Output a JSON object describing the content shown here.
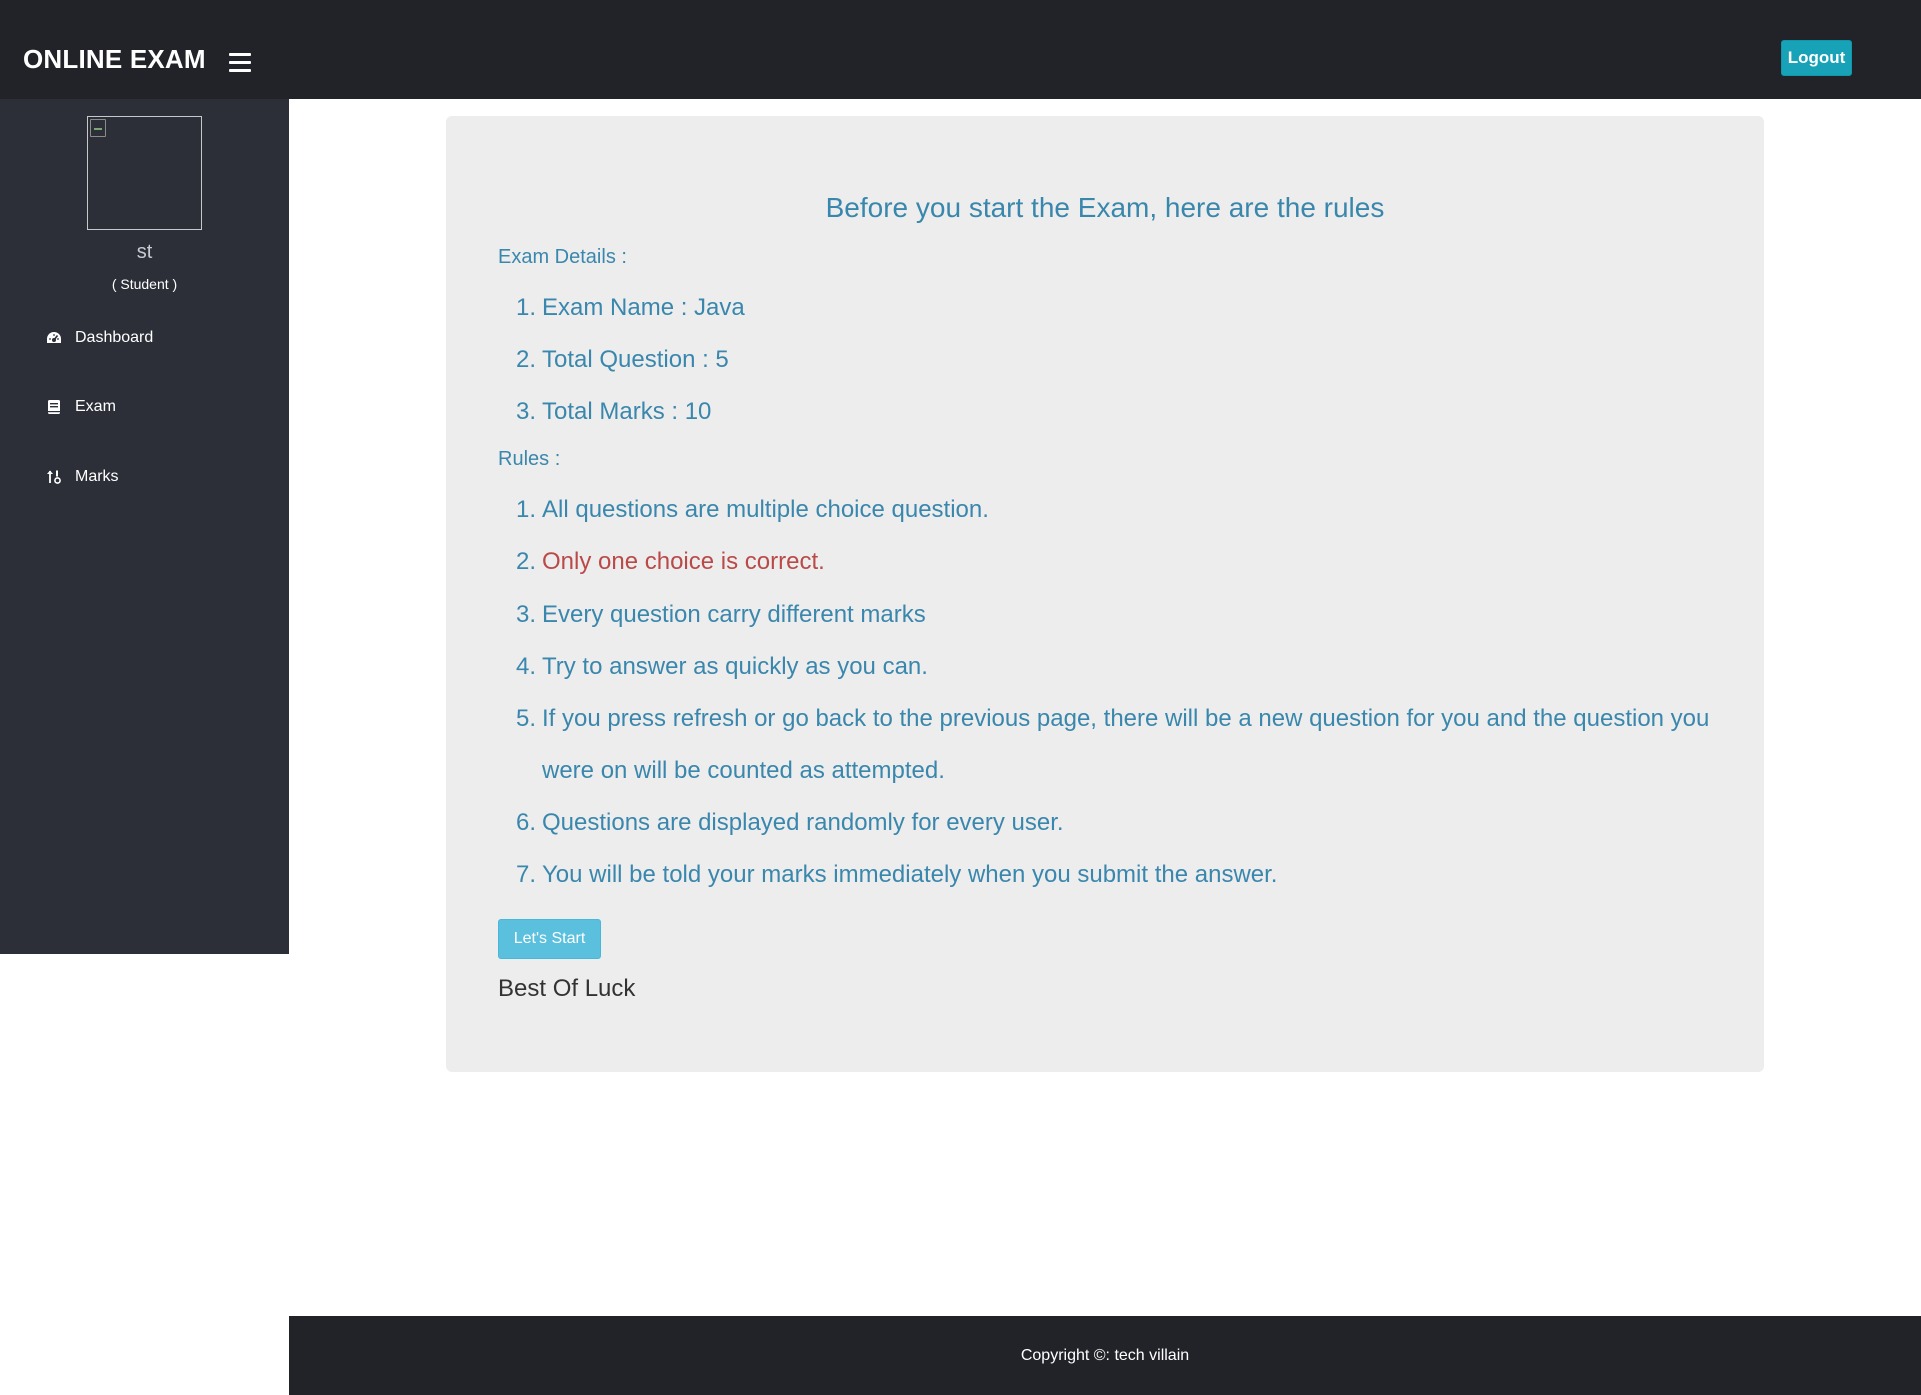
{
  "header": {
    "brand": "ONLINE EXAM",
    "menu_icon": "hamburger-menu-icon",
    "logout_label": "Logout"
  },
  "sidebar": {
    "avatar_icon": "broken-image-icon",
    "user_name": "st",
    "user_role": "( Student )",
    "items": [
      {
        "label": "Dashboard",
        "icon": "dashboard-icon"
      },
      {
        "label": "Exam",
        "icon": "book-icon"
      },
      {
        "label": "Marks",
        "icon": "sort-numeric-icon"
      }
    ]
  },
  "main": {
    "title": "Before you start the Exam, here are the rules",
    "exam_details_label": "Exam Details :",
    "exam_details": [
      {
        "num": "1.",
        "text": "Exam Name : Java"
      },
      {
        "num": "2.",
        "text": "Total Question : 5"
      },
      {
        "num": "3.",
        "text": "Total Marks : 10"
      }
    ],
    "rules_label": "Rules :",
    "rules": [
      {
        "num": "1.",
        "text": "All questions are multiple choice question."
      },
      {
        "num": "2.",
        "text": "Only one choice is correct."
      },
      {
        "num": "3.",
        "text": "Every question carry different marks"
      },
      {
        "num": "4.",
        "text": "Try to answer as quickly as you can."
      },
      {
        "num": "5.",
        "text": "If you press refresh or go back to the previous page, there will be a new question for you and the question you were on will be counted as attempted."
      },
      {
        "num": "6.",
        "text": "Questions are displayed randomly for every user."
      },
      {
        "num": "7.",
        "text": "You will be told your marks immediately when you submit the answer."
      }
    ],
    "start_label": "Let's Start",
    "closing": "Best Of Luck"
  },
  "footer": {
    "copyright": "Copyright ©: tech villain"
  },
  "colors": {
    "topbar": "#212329",
    "sidebar": "#2c2f38",
    "text_primary": "#3a87ad",
    "text_danger": "#b94a48",
    "logout_button": "#17a2b8",
    "start_button": "#5bc0de",
    "panel": "#ededed"
  }
}
